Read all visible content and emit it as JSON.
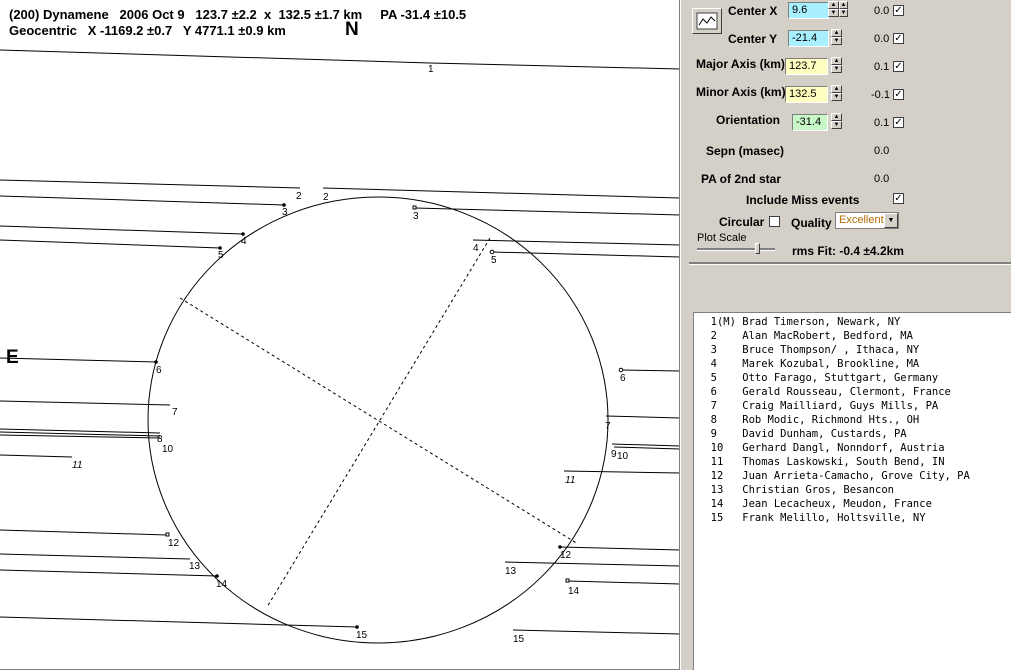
{
  "header": {
    "line1": "(200) Dynamene   2006 Oct 9   123.7 ±2.2  x  132.5 ±1.7 km     PA -31.4 ±10.5",
    "line2": "Geocentric   X -1169.2 ±0.7   Y 4771.1 ±0.9 km",
    "north": "N",
    "east": "E"
  },
  "chords": {
    "left_labels": [
      "1",
      "2",
      "3",
      "4",
      "5",
      "6",
      "7",
      "8",
      "9",
      "10",
      "11",
      "12",
      "13",
      "14",
      "15"
    ],
    "right_labels": [
      "2",
      "3",
      "4",
      "5",
      "6",
      "7",
      "9",
      "10",
      "11",
      "12",
      "13",
      "14",
      "15"
    ]
  },
  "controls": {
    "center_x": {
      "label": "Center X",
      "value": "9.6",
      "fit": "0.0"
    },
    "center_y": {
      "label": "Center Y",
      "value": "-21.4",
      "fit": "0.0"
    },
    "major_axis": {
      "label": "Major Axis (km)",
      "value": "123.7",
      "fit": "0.1"
    },
    "minor_axis": {
      "label": "Minor Axis (km)",
      "value": "132.5",
      "fit": "-0.1"
    },
    "orientation": {
      "label": "Orientation",
      "value": "-31.4",
      "fit": "0.1"
    },
    "sepn": {
      "label": "Sepn (masec)",
      "value": "0.0"
    },
    "pa2": {
      "label": "PA of 2nd star",
      "value": "0.0"
    },
    "include_miss": {
      "label": "Include Miss events"
    },
    "circular": {
      "label": "Circular"
    },
    "quality": {
      "label": "Quality",
      "value": "Excellent"
    },
    "plot_scale": {
      "label": "Plot Scale"
    },
    "rms": {
      "label": "rms Fit: -0.4 ±4.2km"
    }
  },
  "colors": {
    "center_bg": "#a8f0ff",
    "axis_bg": "#ffffc0",
    "orient_bg": "#c8f8c8"
  },
  "observers": [
    "  1(M) Brad Timerson, Newark, NY",
    "  2    Alan MacRobert, Bedford, MA",
    "  3    Bruce Thompson/ , Ithaca, NY",
    "  4    Marek Kozubal, Brookline, MA",
    "  5    Otto Farago, Stuttgart, Germany",
    "  6    Gerald Rousseau, Clermont, France",
    "  7    Craig Mailliard, Guys Mills, PA",
    "  8    Rob Modic, Richmond Hts., OH",
    "  9    David Dunham, Custards, PA",
    "  10   Gerhard Dangl, Nonndorf, Austria",
    "  11   Thomas Laskowski, South Bend, IN",
    "  12   Juan Arrieta-Camacho, Grove City, PA",
    "  13   Christian Gros, Besancon",
    "  14   Jean Lecacheux, Meudon, France",
    "  15   Frank Melillo, Holtsville, NY"
  ]
}
